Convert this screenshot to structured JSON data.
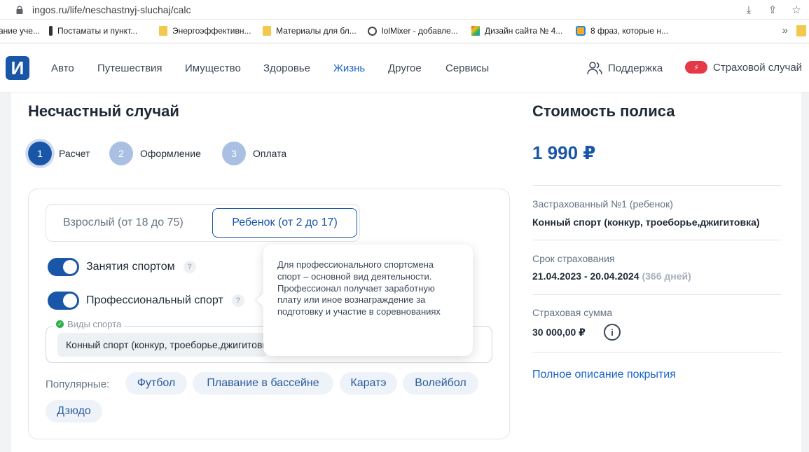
{
  "browser": {
    "url": "ingos.ru/life/neschastnyj-sluchaj/calc",
    "bookmarks": [
      "ание уче...",
      "Постаматы и пункт...",
      "Энергоэффективн...",
      "Материалы для бл...",
      "lolMixer - добавле...",
      "Дизайн сайта № 4...",
      "8 фраз, которые н..."
    ],
    "more": "»"
  },
  "header": {
    "logo": "И",
    "nav": [
      "Авто",
      "Путешествия",
      "Имущество",
      "Здоровье",
      "Жизнь",
      "Другое",
      "Сервисы"
    ],
    "active_nav": "Жизнь",
    "support": "Поддержка",
    "claim": "Страховой случай",
    "accent": "#1a56a8",
    "claim_color": "#e63946"
  },
  "main": {
    "title": "Несчастный случай",
    "steps": [
      {
        "num": "1",
        "label": "Расчет"
      },
      {
        "num": "2",
        "label": "Оформление"
      },
      {
        "num": "3",
        "label": "Оплата"
      }
    ],
    "segment": {
      "adult": "Взрослый (от 18 до 75)",
      "child": "Ребенок (от 2 до 17)"
    },
    "toggles": {
      "sport": "Занятия спортом",
      "pro": "Профессиональный спорт",
      "help": "?"
    },
    "tooltip": "Для профессионального спортсмена спорт – основной вид деятельности. Профессионал получает заработную плату или иное вознаграждение за подготовку и участие в соревнованиях",
    "sport_field": {
      "label": "Виды спорта",
      "value": "Конный спорт (конкур, троеборье,джигитовка)"
    },
    "popular_label": "Популярные:",
    "popular": [
      "Футбол",
      "Плавание в бассейне",
      "Каратэ",
      "Волейбол",
      "Дзюдо"
    ]
  },
  "summary": {
    "title": "Стоимость полиса",
    "price": "1 990 ₽",
    "insured_label": "Застрахованный №1 (ребенок)",
    "insured_value": "Конный спорт (конкур, троеборье,джигитовка)",
    "term_label": "Срок страхования",
    "term_value": "21.04.2023 - 20.04.2024",
    "term_days": "(366 дней)",
    "sum_label": "Страховая сумма",
    "sum_value": "30 000,00 ₽",
    "info": "i",
    "coverage_link": "Полное описание покрытия"
  }
}
